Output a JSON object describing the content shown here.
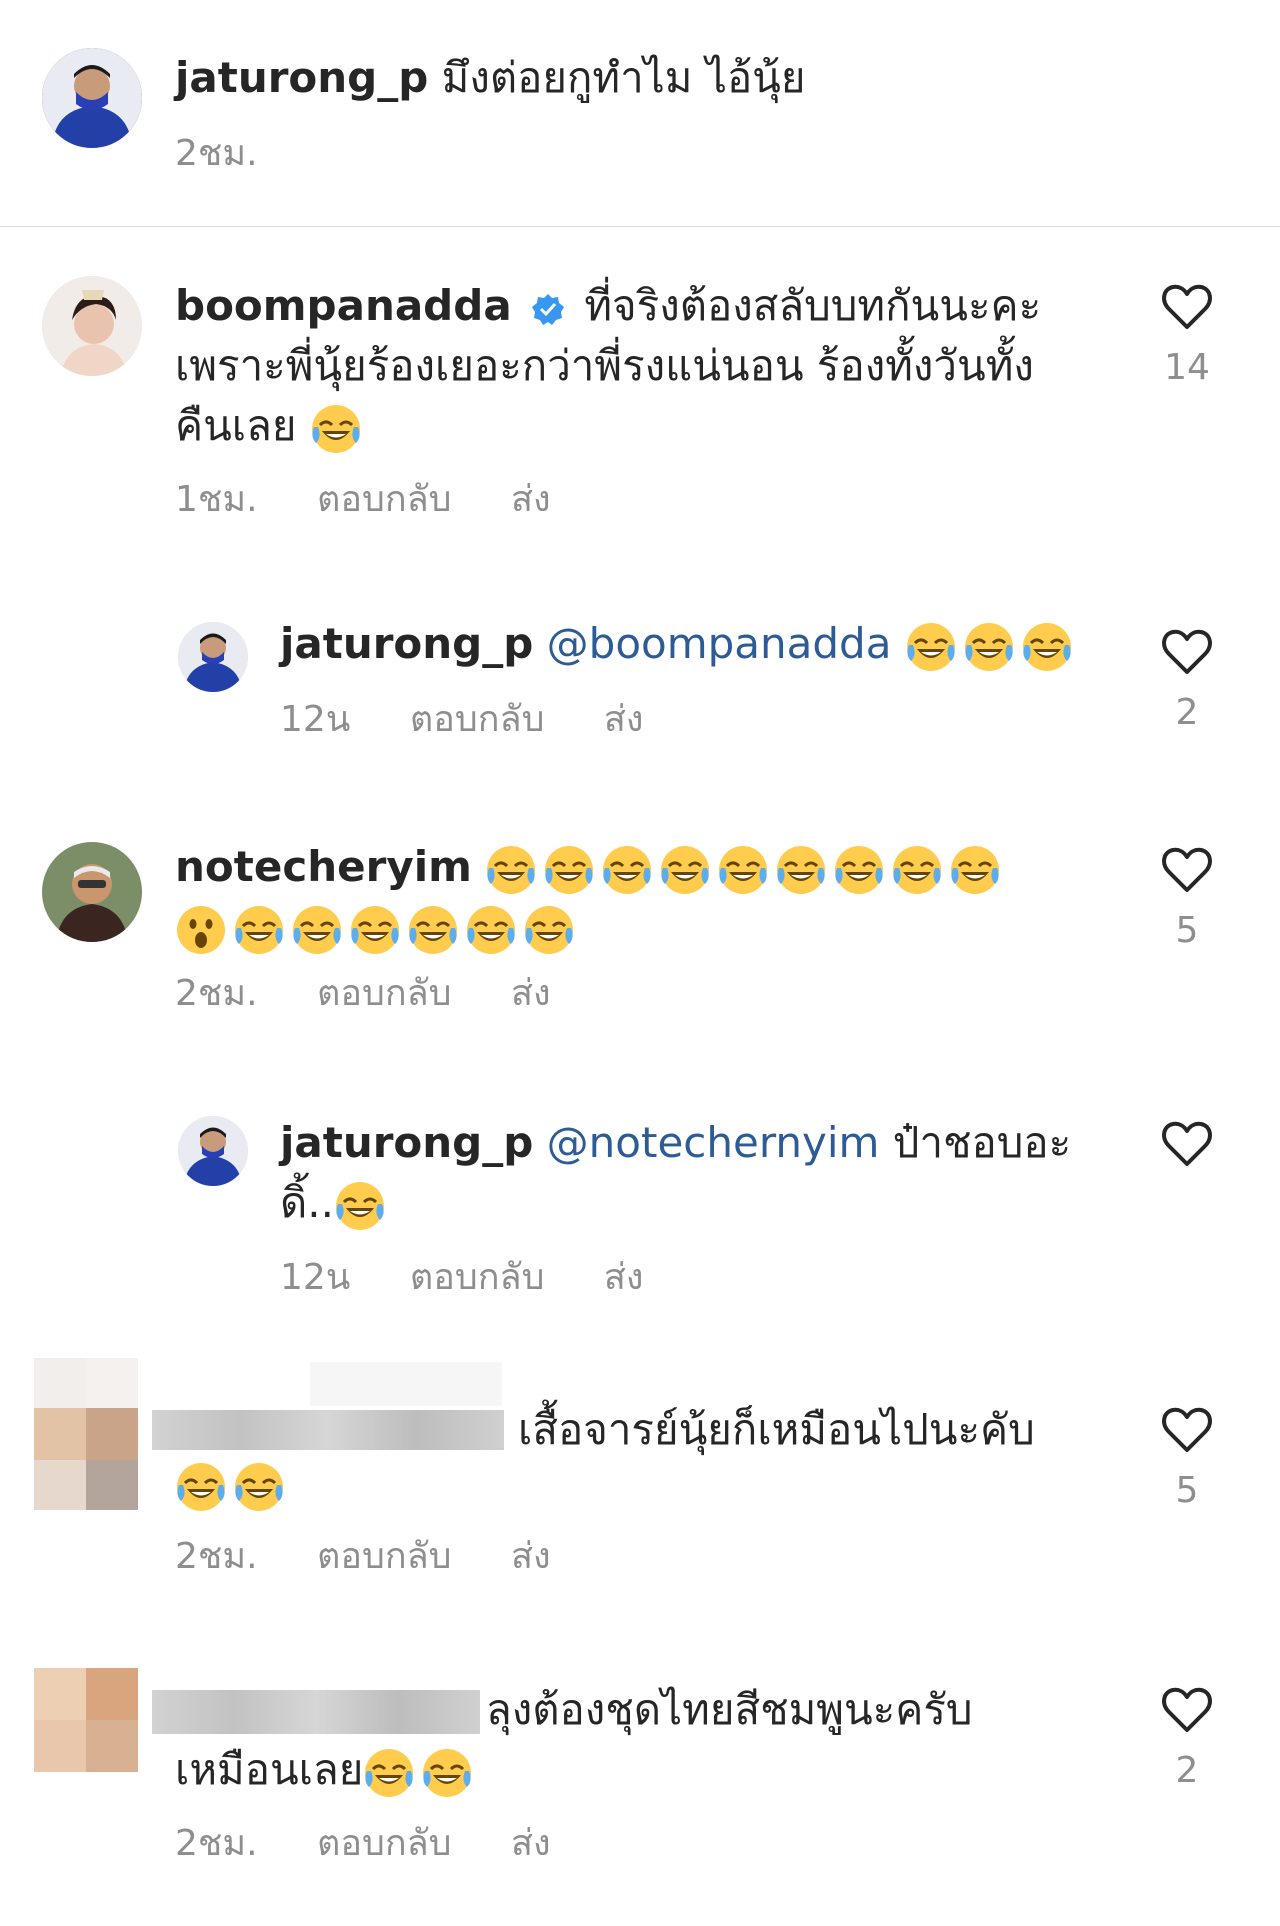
{
  "caption": {
    "username": "jaturong_p",
    "text": "มึงต่อยกูทำไม ไอ้นุ้ย",
    "time": "2ชม."
  },
  "labels": {
    "reply": "ตอบกลับ",
    "send": "ส่ง"
  },
  "comments": [
    {
      "username": "boompanadda",
      "verified": true,
      "line1": "ที่จริงต้องสลับบทกันนะคะ",
      "line2": "เพราะพี่นุ้ยร้องเยอะกว่าพี่รงแน่นอน ร้องทั้งวันทั้ง",
      "line3": "คืนเลย",
      "time": "1ชม.",
      "likes": "14"
    },
    {
      "username": "jaturong_p",
      "mention": "@boompanadda",
      "time": "12น",
      "likes": "2"
    },
    {
      "username": "notecheryim",
      "time": "2ชม.",
      "likes": "5"
    },
    {
      "username": "jaturong_p",
      "mention": "@notechernyim",
      "text": "ป๋าชอบอะ",
      "line2": "ดิ้..",
      "time": "12น",
      "likes": ""
    },
    {
      "text": "เสื้อจารย์นุ้ยก็เหมือนไปนะคับ",
      "time": "2ชม.",
      "likes": "5"
    },
    {
      "text": "ลุงต้องชุดไทยสีชมพูนะครับ",
      "line2": "เหมือนเลย",
      "time": "2ชม.",
      "likes": "2"
    }
  ]
}
